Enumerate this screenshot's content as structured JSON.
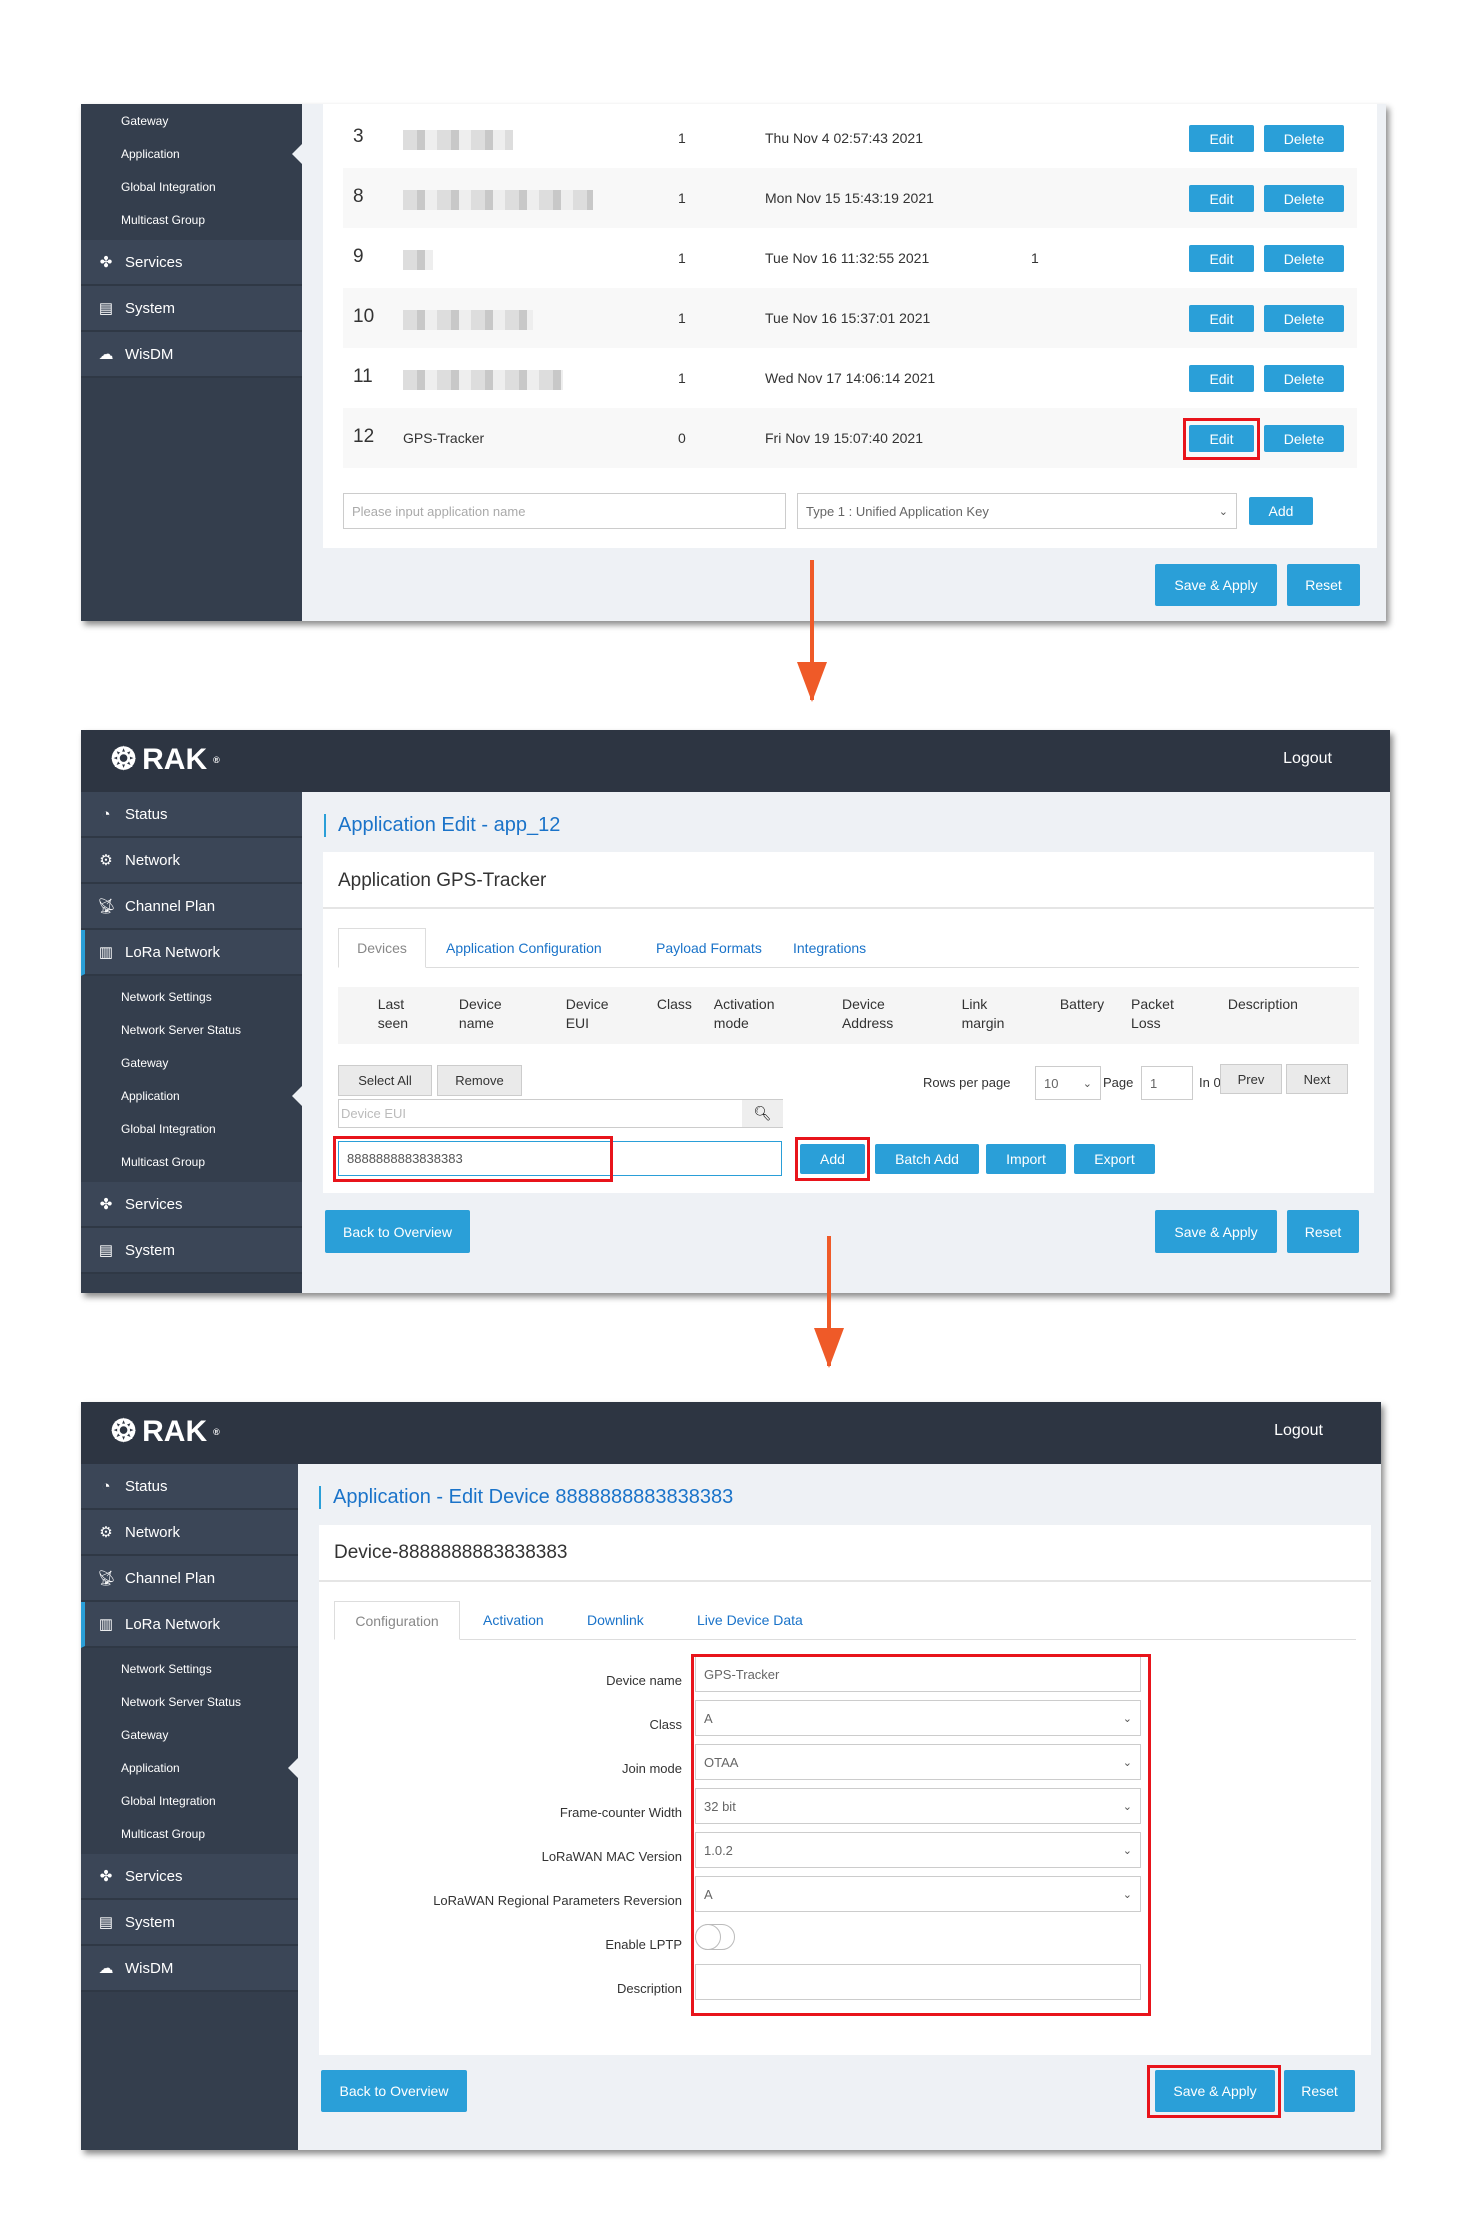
{
  "colors": {
    "accent": "#2a9fd8",
    "sidebar": "#343e4d",
    "header": "#2d3542",
    "highlight": "#e8141b",
    "arrow": "#ef5a28"
  },
  "panel1": {
    "sidebar": {
      "sub_items": [
        "Gateway",
        "Application",
        "Global Integration",
        "Multicast Group"
      ],
      "items": [
        {
          "label": "Services",
          "icon": "services-icon"
        },
        {
          "label": "System",
          "icon": "system-icon"
        },
        {
          "label": "WisDM",
          "icon": "cloud-icon"
        }
      ]
    },
    "rows": [
      {
        "id": "3",
        "count": "1",
        "date": "Thu Nov 4 02:57:43 2021",
        "extra": ""
      },
      {
        "id": "8",
        "count": "1",
        "date": "Mon Nov 15 15:43:19 2021",
        "extra": ""
      },
      {
        "id": "9",
        "count": "1",
        "date": "Tue Nov 16 11:32:55 2021",
        "extra": "1"
      },
      {
        "id": "10",
        "count": "1",
        "date": "Tue Nov 16 15:37:01 2021",
        "extra": ""
      },
      {
        "id": "11",
        "count": "1",
        "date": "Wed Nov 17 14:06:14 2021",
        "extra": ""
      },
      {
        "id": "12",
        "name": "GPS-Tracker",
        "count": "0",
        "date": "Fri Nov 19 15:07:40 2021",
        "extra": ""
      }
    ],
    "edit_label": "Edit",
    "delete_label": "Delete",
    "name_placeholder": "Please input application name",
    "type_select": "Type 1 : Unified Application Key",
    "add_label": "Add",
    "save_label": "Save & Apply",
    "reset_label": "Reset"
  },
  "panel2": {
    "logo": "RAK",
    "logout": "Logout",
    "sidebar": {
      "items": [
        {
          "label": "Status",
          "icon": "status-icon"
        },
        {
          "label": "Network",
          "icon": "network-icon"
        },
        {
          "label": "Channel Plan",
          "icon": "antenna-icon"
        },
        {
          "label": "LoRa Network",
          "icon": "bar-chart-icon"
        }
      ],
      "sub_items": [
        "Network Settings",
        "Network Server Status",
        "Gateway",
        "Application",
        "Global Integration",
        "Multicast Group"
      ],
      "bottom": [
        {
          "label": "Services",
          "icon": "services-icon"
        },
        {
          "label": "System",
          "icon": "system-icon"
        }
      ]
    },
    "page_title": "Application Edit - app_12",
    "card_title": "Application GPS-Tracker",
    "tabs": [
      "Devices",
      "Application Configuration",
      "Payload Formats",
      "Integrations"
    ],
    "columns": [
      "Last\nseen",
      "Device\nname",
      "Device\nEUI",
      "Class",
      "Activation\nmode",
      "Device\nAddress",
      "Link\nmargin",
      "Battery",
      "Packet\nLoss",
      "Description"
    ],
    "select_all": "Select All",
    "remove": "Remove",
    "rows_per_page_label": "Rows per page",
    "rows_per_page": "10",
    "page_label": "Page",
    "page": "1",
    "in_label": "In 0",
    "prev": "Prev",
    "next": "Next",
    "search_placeholder": "Device EUI",
    "eui_value": "8888888883838383",
    "add": "Add",
    "batch_add": "Batch Add",
    "import": "Import",
    "export": "Export",
    "back": "Back to Overview",
    "save": "Save & Apply",
    "reset": "Reset"
  },
  "panel3": {
    "logo": "RAK",
    "logout": "Logout",
    "sidebar": {
      "items": [
        {
          "label": "Status",
          "icon": "status-icon"
        },
        {
          "label": "Network",
          "icon": "network-icon"
        },
        {
          "label": "Channel Plan",
          "icon": "antenna-icon"
        },
        {
          "label": "LoRa Network",
          "icon": "bar-chart-icon"
        }
      ],
      "sub_items": [
        "Network Settings",
        "Network Server Status",
        "Gateway",
        "Application",
        "Global Integration",
        "Multicast Group"
      ],
      "bottom": [
        {
          "label": "Services",
          "icon": "services-icon"
        },
        {
          "label": "System",
          "icon": "system-icon"
        },
        {
          "label": "WisDM",
          "icon": "cloud-icon"
        }
      ]
    },
    "page_title": "Application - Edit Device 8888888883838383",
    "card_title": "Device-8888888883838383",
    "tabs": [
      "Configuration",
      "Activation",
      "Downlink",
      "Live Device Data"
    ],
    "form": [
      {
        "label": "Device name",
        "value": "GPS-Tracker",
        "type": "text"
      },
      {
        "label": "Class",
        "value": "A",
        "type": "select"
      },
      {
        "label": "Join mode",
        "value": "OTAA",
        "type": "select"
      },
      {
        "label": "Frame-counter Width",
        "value": "32 bit",
        "type": "select"
      },
      {
        "label": "LoRaWAN MAC Version",
        "value": "1.0.2",
        "type": "select"
      },
      {
        "label": "LoRaWAN Regional Parameters Reversion",
        "value": "A",
        "type": "select"
      },
      {
        "label": "Enable LPTP",
        "value": false,
        "type": "toggle"
      },
      {
        "label": "Description",
        "value": "",
        "type": "text"
      }
    ],
    "back": "Back to Overview",
    "save": "Save & Apply",
    "reset": "Reset"
  }
}
